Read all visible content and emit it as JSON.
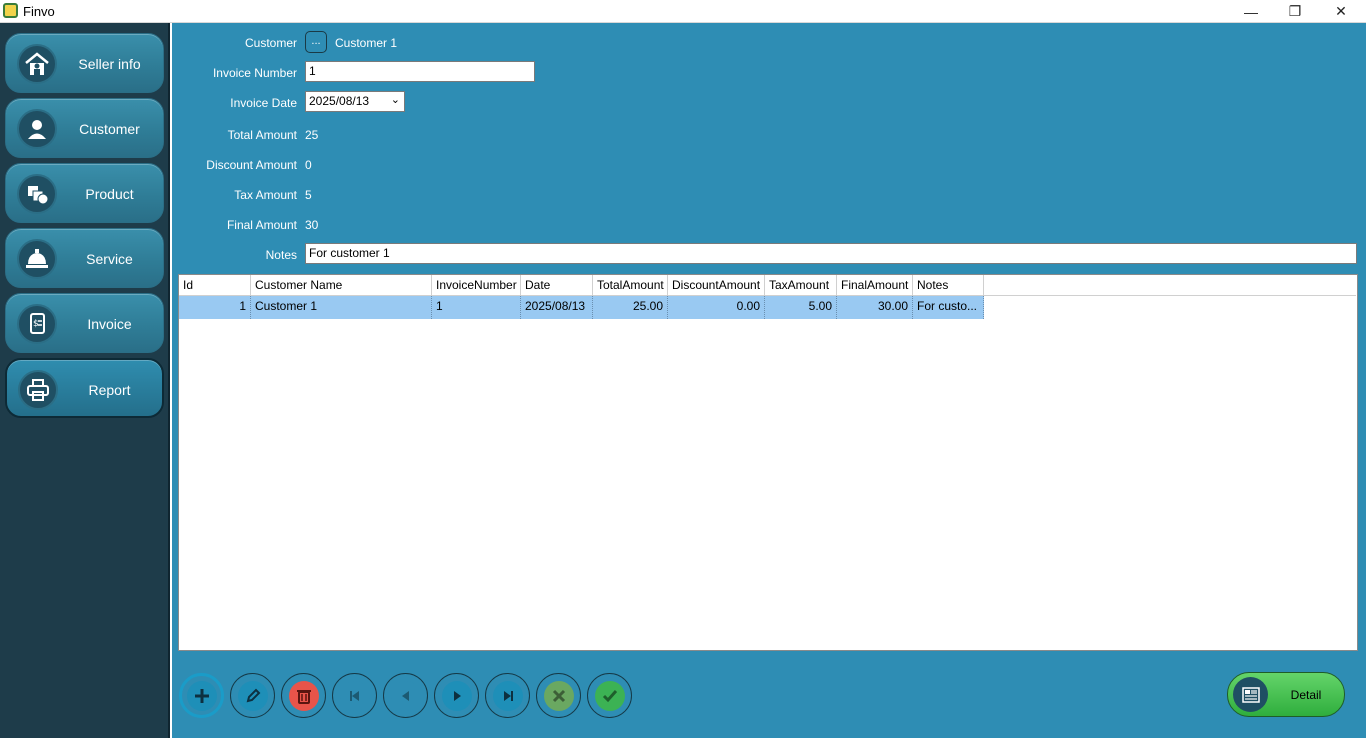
{
  "window": {
    "title": "Finvo",
    "minimize": "—",
    "restore": "❐",
    "close": "✕"
  },
  "sidebar": {
    "items": [
      {
        "label": "Seller info",
        "icon": "house-person-icon"
      },
      {
        "label": "Customer",
        "icon": "person-icon"
      },
      {
        "label": "Product",
        "icon": "boxes-icon"
      },
      {
        "label": "Service",
        "icon": "service-bell-icon"
      },
      {
        "label": "Invoice",
        "icon": "invoice-icon"
      },
      {
        "label": "Report",
        "icon": "printer-icon"
      }
    ],
    "active_index": 5
  },
  "form": {
    "customer_label": "Customer",
    "customer_button": "...",
    "customer_value": "Customer 1",
    "invoice_number_label": "Invoice Number",
    "invoice_number_value": "1",
    "invoice_date_label": "Invoice Date",
    "invoice_date_value": "2025/08/13",
    "total_amount_label": "Total Amount",
    "total_amount_value": "25",
    "discount_amount_label": "Discount Amount",
    "discount_amount_value": "0",
    "tax_amount_label": "Tax Amount",
    "tax_amount_value": "5",
    "final_amount_label": "Final Amount",
    "final_amount_value": "30",
    "notes_label": "Notes",
    "notes_value": "For customer 1"
  },
  "grid": {
    "columns": [
      "Id",
      "Customer Name",
      "InvoiceNumber",
      "Date",
      "TotalAmount",
      "DiscountAmount",
      "TaxAmount",
      "FinalAmount",
      "Notes"
    ],
    "rows": [
      [
        "1",
        "Customer 1",
        "1",
        "2025/08/13",
        "25.00",
        "0.00",
        "5.00",
        "30.00",
        "For custo..."
      ]
    ]
  },
  "toolbar": {
    "buttons": [
      {
        "name": "add-button",
        "icon": "plus-icon",
        "color": "#1e8fb8"
      },
      {
        "name": "edit-button",
        "icon": "pencil-icon",
        "color": "#1e8fb8"
      },
      {
        "name": "delete-button",
        "icon": "trash-icon",
        "color": "#e8544a"
      },
      {
        "name": "first-button",
        "icon": "first-record-icon",
        "color": "#2e8db4"
      },
      {
        "name": "previous-button",
        "icon": "previous-record-icon",
        "color": "#2e8db4"
      },
      {
        "name": "next-button",
        "icon": "next-record-icon",
        "color": "#1e8fb8"
      },
      {
        "name": "last-button",
        "icon": "last-record-icon",
        "color": "#1e8fb8"
      },
      {
        "name": "cancel-button",
        "icon": "x-icon",
        "color": "#6aa861"
      },
      {
        "name": "confirm-button",
        "icon": "check-icon",
        "color": "#3cb254"
      }
    ],
    "detail_label": "Detail"
  }
}
